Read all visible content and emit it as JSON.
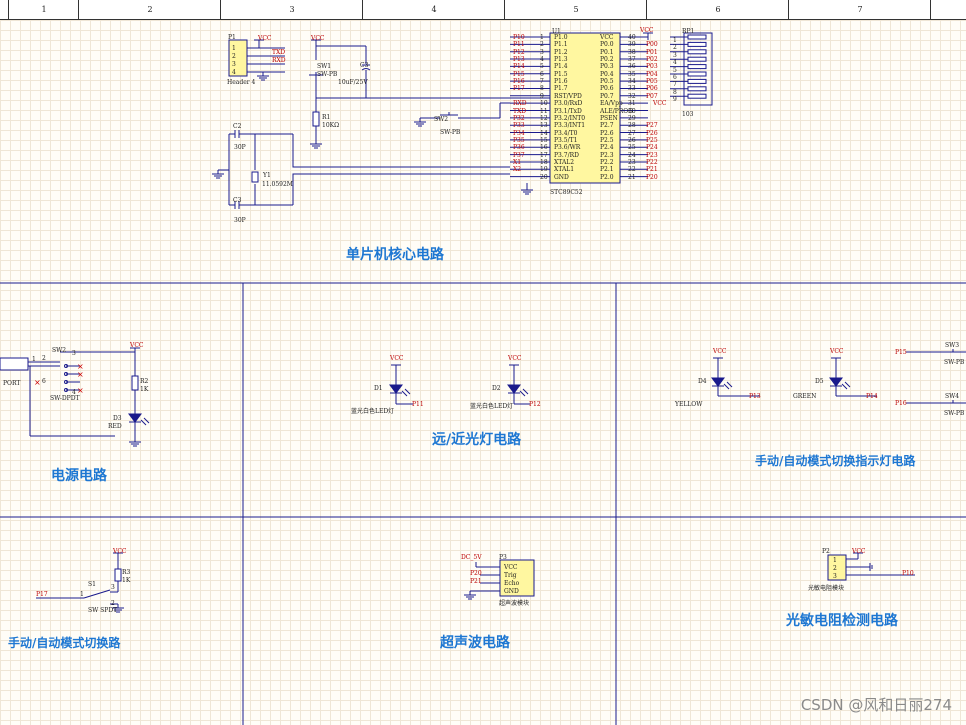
{
  "ruler": [
    "1",
    "2",
    "3",
    "4",
    "5",
    "6",
    "7"
  ],
  "sections": {
    "mcu": "单片机核心电路",
    "power": "电源电路",
    "headlight": "远/近光灯电路",
    "indicator": "手动/自动模式切换指示灯电路",
    "mode_switch": "手动/自动模式切换路",
    "ultrasonic": "超声波电路",
    "photo": "光敏电阻检测电路"
  },
  "mcu": {
    "ref": "U1",
    "part": "STC89C52",
    "left_pins": [
      "P1.0",
      "P1.1",
      "P1.2",
      "P1.3",
      "P1.4",
      "P1.5",
      "P1.6",
      "P1.7",
      "RST/VPD",
      "P3.0/RxD",
      "P3.1/TxD",
      "P3.2/INT0",
      "P3.3/INT1",
      "P3.4/T0",
      "P3.5/T1",
      "P3.6/WR",
      "P3.7/RD",
      "XTAL2",
      "XTAL1",
      "GND"
    ],
    "left_nums": [
      "1",
      "2",
      "3",
      "4",
      "5",
      "6",
      "7",
      "8",
      "9",
      "10",
      "11",
      "12",
      "13",
      "14",
      "15",
      "16",
      "17",
      "18",
      "19",
      "20"
    ],
    "left_nets": [
      "P10",
      "P11",
      "P12",
      "P13",
      "P14",
      "P15",
      "P16",
      "P17",
      "",
      "RXD",
      "TXD",
      "P32",
      "P33",
      "P34",
      "P35",
      "P36",
      "P37",
      "X1",
      "X2",
      ""
    ],
    "right_pins": [
      "VCC",
      "P0.0",
      "P0.1",
      "P0.2",
      "P0.3",
      "P0.4",
      "P0.5",
      "P0.6",
      "P0.7",
      "EA/Vpp",
      "ALE/PROG",
      "PSEN",
      "P2.7",
      "P2.6",
      "P2.5",
      "P2.4",
      "P2.3",
      "P2.2",
      "P2.1",
      "P2.0"
    ],
    "right_nums": [
      "40",
      "39",
      "38",
      "37",
      "36",
      "35",
      "34",
      "33",
      "32",
      "31",
      "30",
      "29",
      "28",
      "27",
      "26",
      "25",
      "24",
      "23",
      "22",
      "21"
    ],
    "right_nets": [
      "VCC",
      "P00",
      "P01",
      "P02",
      "P03",
      "P04",
      "P05",
      "P06",
      "P07",
      "VCC",
      "",
      "",
      "P27",
      "P26",
      "P25",
      "P24",
      "P23",
      "P22",
      "P21",
      "P20"
    ]
  },
  "rp1": {
    "ref": "RP1",
    "part": "103",
    "nums": [
      "1",
      "2",
      "3",
      "4",
      "5",
      "6",
      "7",
      "8",
      "9"
    ]
  },
  "header": {
    "ref": "P1",
    "part": "Header 4",
    "pins": [
      "1",
      "2",
      "3",
      "4"
    ],
    "nets": [
      "VCC",
      "TXD",
      "RXD",
      ""
    ]
  },
  "reset": {
    "sw": "SW1",
    "sw_part": "SW-PB",
    "cap": "C3",
    "cap_val": "10uF/25V",
    "res": "R1",
    "res_val": "10KΩ",
    "vcc": "VCC"
  },
  "sw2_mcu": {
    "ref": "SW2",
    "part": "SW-PB"
  },
  "crystal": {
    "c1": "C2",
    "c1_val": "30P",
    "c2": "C3",
    "c2_val": "30P",
    "y": "Y1",
    "y_val": "11.0592M"
  },
  "power": {
    "sw": "SW2",
    "sw_part": "SW-DPDT",
    "port": "PORT",
    "r": "R2",
    "r_val": "1K",
    "led": "D3",
    "led_val": "RED",
    "vcc": "VCC",
    "pins": [
      "1",
      "2",
      "3",
      "4",
      "5",
      "6"
    ]
  },
  "headlight": [
    {
      "ref": "D1",
      "desc": "蓝光白色LED灯",
      "net": "P11",
      "vcc": "VCC"
    },
    {
      "ref": "D2",
      "desc": "蓝光白色LED灯",
      "net": "P12",
      "vcc": "VCC"
    }
  ],
  "indicator": [
    {
      "ref": "D4",
      "desc": "YELLOW",
      "net": "P13",
      "vcc": "VCC"
    },
    {
      "ref": "D5",
      "desc": "GREEN",
      "net": "P14",
      "vcc": "VCC"
    }
  ],
  "buttons_right": [
    {
      "ref": "SW3",
      "part": "SW-PB",
      "net": "P15"
    },
    {
      "ref": "SW4",
      "part": "SW-PB",
      "net": "P16"
    }
  ],
  "mode_switch": {
    "sw": "S1",
    "part": "SW SPDT",
    "r": "R3",
    "r_val": "1K",
    "net": "P17",
    "vcc": "VCC",
    "pin1": "1",
    "pin2": "2",
    "pin3": "3"
  },
  "ultrasonic": {
    "ref": "P3",
    "desc": "超声波模块",
    "pins": [
      "VCC",
      "Trig",
      "Echo",
      "GND"
    ],
    "nets": [
      "DC_5V",
      "P20",
      "P21",
      ""
    ]
  },
  "photo": {
    "ref": "P2",
    "desc": "光敏电阻模块",
    "pins": [
      "1",
      "2",
      "3"
    ],
    "net": "P10",
    "vcc": "VCC"
  },
  "watermark": "CSDN @风和日丽274",
  "colors": {
    "wire": "#1a1a8c",
    "component": "#1a1a8c",
    "fill": "#fff7a0",
    "title": "#1e77d2",
    "net": "#b00000",
    "led": "#1a1a8c"
  }
}
